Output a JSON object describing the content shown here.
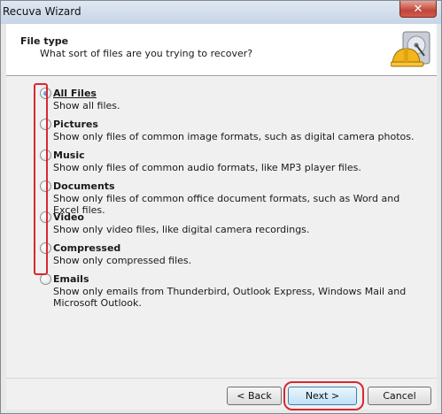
{
  "window": {
    "title": "Recuva Wizard",
    "close_label": "✕"
  },
  "header": {
    "title": "File type",
    "subtitle": "What sort of files are you trying to recover?",
    "icon": "hard-drive-hardhat-icon"
  },
  "options": [
    {
      "label": "All Files",
      "description": "Show all files.",
      "selected": true
    },
    {
      "label": "Pictures",
      "description": "Show only files of common image formats, such as digital camera photos.",
      "selected": false
    },
    {
      "label": "Music",
      "description": "Show only files of common audio formats, like MP3 player files.",
      "selected": false
    },
    {
      "label": "Documents",
      "description": "Show only files of common office document formats, such as Word and Excel files.",
      "selected": false
    },
    {
      "label": "Video",
      "description": "Show only video files, like digital camera recordings.",
      "selected": false
    },
    {
      "label": "Compressed",
      "description": "Show only compressed files.",
      "selected": false
    },
    {
      "label": "Emails",
      "description": "Show only emails from Thunderbird, Outlook Express, Windows Mail and Microsoft Outlook.",
      "selected": false
    }
  ],
  "buttons": {
    "back": "< Back",
    "next": "Next >",
    "cancel": "Cancel"
  },
  "annotation_color": "#d8282f"
}
